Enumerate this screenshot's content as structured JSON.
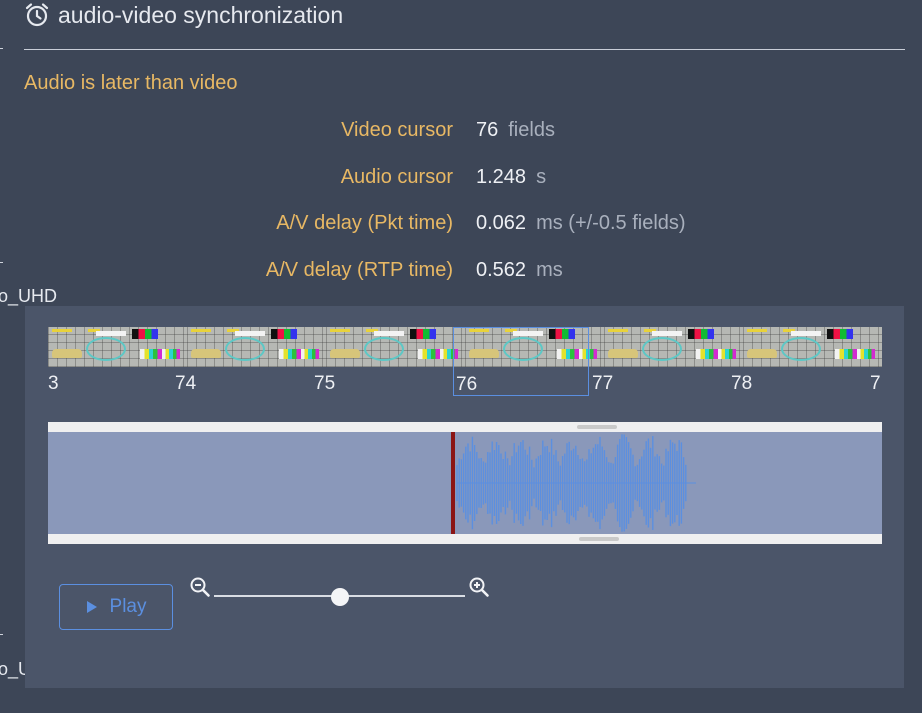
{
  "header": {
    "title": "audio-video synchronization",
    "icon": "alarm-clock-icon"
  },
  "left_edge": {
    "label_top": "o_UHD",
    "label_bottom": "o_U"
  },
  "warning": "Audio is later than video",
  "fields": [
    {
      "label": "Video cursor",
      "value": "76",
      "unit": "fields"
    },
    {
      "label": "Audio cursor",
      "value": "1.248",
      "unit": "s"
    },
    {
      "label": "A/V delay (Pkt time)",
      "value": "0.062",
      "unit": "ms (+/-0.5 fields)"
    },
    {
      "label": "A/V delay (RTP time)",
      "value": "0.562",
      "unit": "ms"
    }
  ],
  "timeline": {
    "ticks": [
      "3",
      "74",
      "75",
      "76",
      "77",
      "78",
      "7"
    ],
    "selected_field": "76"
  },
  "controls": {
    "play_label": "Play",
    "zoom_out_icon": "zoom-out-icon",
    "zoom_in_icon": "zoom-in-icon",
    "zoom_level": 0.5
  },
  "colors": {
    "accent": "#5b8fe0",
    "label": "#e8b864",
    "cursor": "#8b1515",
    "waveform": "#5b8fe0"
  }
}
